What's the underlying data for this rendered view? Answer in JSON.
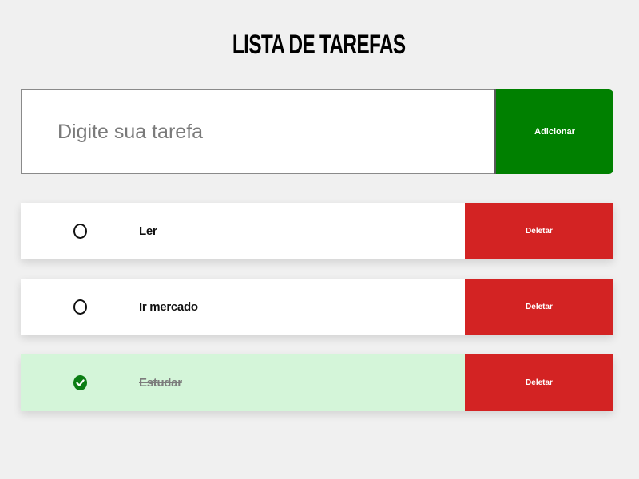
{
  "header": {
    "title": "LISTA DE TAREFAS"
  },
  "form": {
    "placeholder": "Digite sua tarefa",
    "value": "",
    "add_label": "Adicionar",
    "add_color": "#008000"
  },
  "tasks": [
    {
      "text": "Ler",
      "completed": false,
      "delete_label": "Deletar"
    },
    {
      "text": "Ir mercado",
      "completed": false,
      "delete_label": "Deletar"
    },
    {
      "text": "Estudar",
      "completed": true,
      "delete_label": "Deletar"
    }
  ],
  "colors": {
    "background": "#f0f0f0",
    "delete": "#d32323",
    "completed_row": "#d4f5d9",
    "check": "#0b7d14"
  },
  "icons": {
    "unchecked": "circle-outline-icon",
    "checked": "check-circle-icon"
  }
}
